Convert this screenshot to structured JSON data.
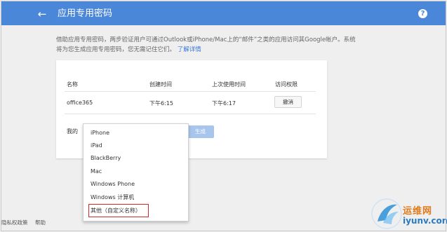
{
  "header": {
    "title": "应用专用密码",
    "back_icon": "arrow-left-icon",
    "back_glyph": "←",
    "help_icon": "question-mark-icon",
    "help_glyph": "?",
    "bar_color": "#4b87d8"
  },
  "intro": {
    "text": "借助应用专用密码，两步验证用户可通过Outlook或iPhone/Mac上的“邮件”之类的应用访问其Google帐户。系统将为您生成应用专用密码，您无需记住它们。",
    "learn_more": "了解详情"
  },
  "table": {
    "headers": [
      "名称",
      "创建时间",
      "上次使用时间",
      "访问权限"
    ],
    "rows": [
      {
        "name": "office365",
        "created": "下午6:15",
        "last_used": "下午6:17",
        "action": "撤消"
      }
    ]
  },
  "generator": {
    "label": "我的",
    "button": "生成",
    "dropdown_options": [
      "iPhone",
      "iPad",
      "BlackBerry",
      "Mac",
      "Windows Phone",
      "Windows 计算机",
      "其他（自定义名称）"
    ],
    "highlighted_option": "其他（自定义名称）"
  },
  "footer": {
    "privacy": "隐私权政策",
    "help": "帮助"
  },
  "watermark": {
    "name": "运维网",
    "domain": "iyunv.com"
  }
}
